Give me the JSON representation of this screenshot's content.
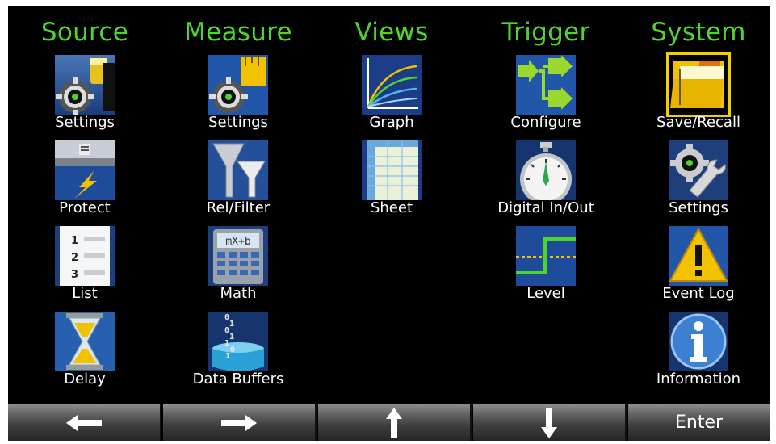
{
  "colors": {
    "heading": "#4fd42e",
    "background": "#000000",
    "label": "#ffffff",
    "selected_outline": "#f2d000"
  },
  "columns": [
    {
      "title": "Source",
      "items": [
        {
          "label": "Settings",
          "icon": "source-settings-icon"
        },
        {
          "label": "Protect",
          "icon": "protect-icon"
        },
        {
          "label": "List",
          "icon": "list-icon"
        },
        {
          "label": "Delay",
          "icon": "hourglass-icon"
        }
      ]
    },
    {
      "title": "Measure",
      "items": [
        {
          "label": "Settings",
          "icon": "measure-settings-icon"
        },
        {
          "label": "Rel/Filter",
          "icon": "filter-funnel-icon"
        },
        {
          "label": "Math",
          "icon": "calculator-icon"
        },
        {
          "label": "Data Buffers",
          "icon": "data-buffers-icon"
        }
      ]
    },
    {
      "title": "Views",
      "items": [
        {
          "label": "Graph",
          "icon": "graph-icon"
        },
        {
          "label": "Sheet",
          "icon": "sheet-icon"
        }
      ]
    },
    {
      "title": "Trigger",
      "items": [
        {
          "label": "Configure",
          "icon": "trigger-configure-icon"
        },
        {
          "label": "Digital In/Out",
          "icon": "stopwatch-icon"
        },
        {
          "label": "Level",
          "icon": "level-waveform-icon"
        }
      ]
    },
    {
      "title": "System",
      "items": [
        {
          "label": "Save/Recall",
          "icon": "folder-icon",
          "selected": true
        },
        {
          "label": "Settings",
          "icon": "system-settings-icon"
        },
        {
          "label": "Event Log",
          "icon": "warning-icon"
        },
        {
          "label": "Information",
          "icon": "info-icon"
        }
      ]
    }
  ],
  "softkeys": [
    {
      "icon": "arrow-left-icon",
      "label": ""
    },
    {
      "icon": "arrow-right-icon",
      "label": ""
    },
    {
      "icon": "arrow-up-icon",
      "label": ""
    },
    {
      "icon": "arrow-down-icon",
      "label": ""
    },
    {
      "icon": "",
      "label": "Enter"
    }
  ]
}
